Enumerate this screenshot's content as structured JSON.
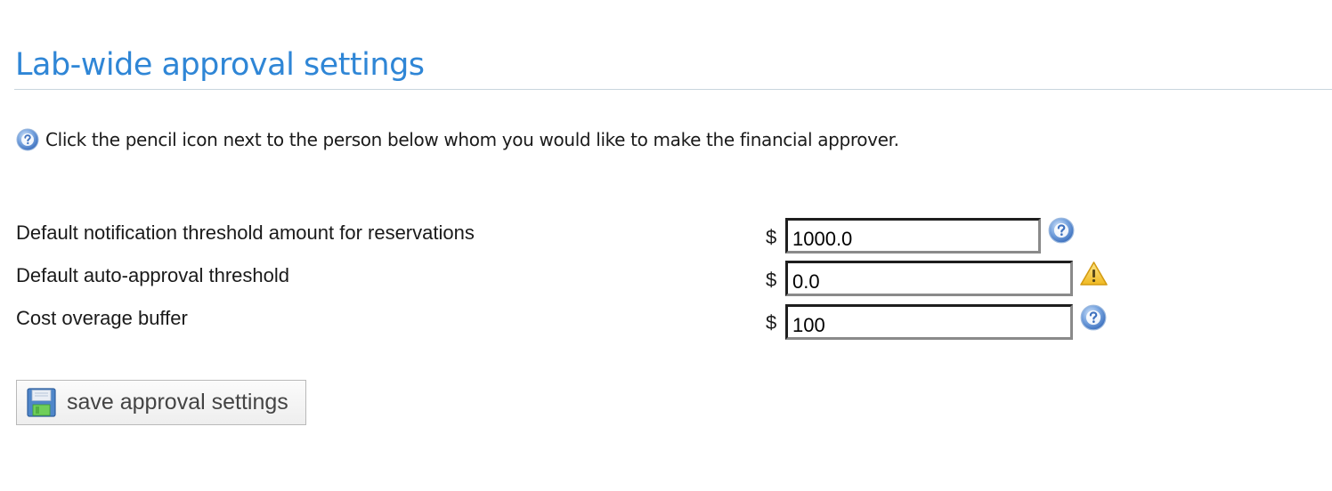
{
  "page": {
    "title": "Lab-wide approval settings",
    "intro": "Click the pencil icon next to the person below whom you would like to make the financial approver.",
    "intro_icon": "help-icon"
  },
  "settings": [
    {
      "label": "Default notification threshold amount for reservations",
      "currency": "$",
      "value": "1000.0",
      "icon": "help-icon"
    },
    {
      "label": "Default auto-approval threshold",
      "currency": "$",
      "value": "0.0",
      "icon": "warning-icon"
    },
    {
      "label": "Cost overage buffer",
      "currency": "$",
      "value": "100",
      "icon": "help-icon"
    }
  ],
  "actions": {
    "save_label": "save approval settings",
    "save_icon": "floppy-disk-icon"
  },
  "colors": {
    "title": "#2f86d6",
    "help_icon": "#5b8ed1",
    "warning_icon": "#f2c230"
  }
}
